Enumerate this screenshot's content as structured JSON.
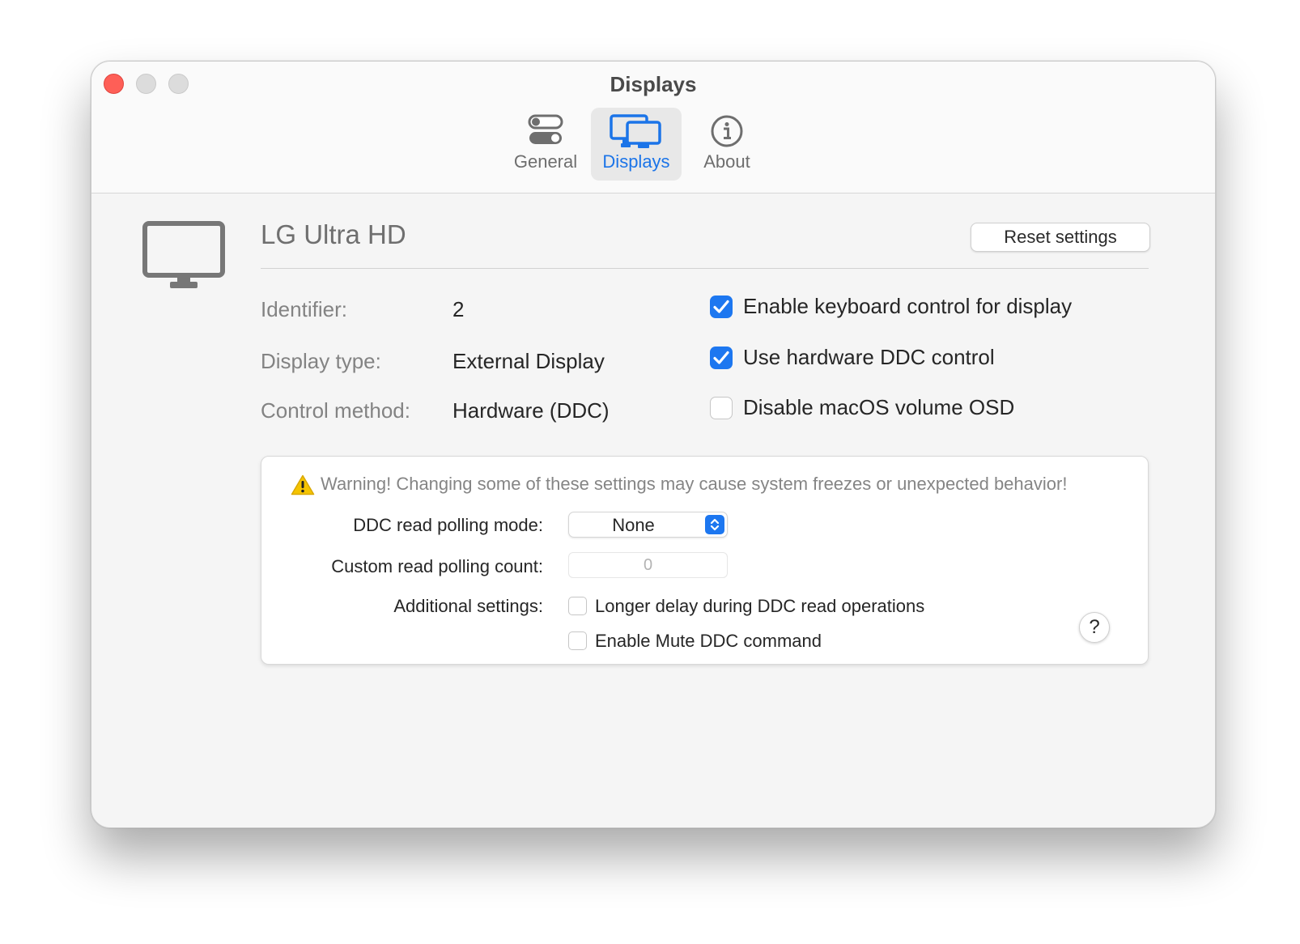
{
  "window": {
    "title": "Displays"
  },
  "tabs": [
    {
      "label": "General",
      "icon": "toggles-icon",
      "active": false
    },
    {
      "label": "Displays",
      "icon": "displays-icon",
      "active": true
    },
    {
      "label": "About",
      "icon": "info-icon",
      "active": false
    }
  ],
  "display": {
    "name": "LG Ultra HD",
    "reset_label": "Reset settings",
    "info": [
      {
        "label": "Identifier:",
        "value": "2"
      },
      {
        "label": "Display type:",
        "value": "External Display"
      },
      {
        "label": "Control method:",
        "value": "Hardware (DDC)"
      }
    ],
    "options": [
      {
        "label": "Enable keyboard control for display",
        "checked": true
      },
      {
        "label": "Use hardware DDC control",
        "checked": true
      },
      {
        "label": "Disable macOS volume OSD",
        "checked": false
      }
    ]
  },
  "advanced": {
    "warning": "Warning! Changing some of these settings may cause system freezes or unexpected behavior!",
    "polling_mode_label": "DDC read polling mode:",
    "polling_mode_value": "None",
    "polling_count_label": "Custom read polling count:",
    "polling_count_placeholder": "0",
    "additional_label": "Additional settings:",
    "additional_options": [
      {
        "label": "Longer delay during DDC read operations",
        "checked": false
      },
      {
        "label": "Enable Mute DDC command",
        "checked": false
      }
    ],
    "help_label": "?"
  },
  "colors": {
    "accent": "#1d77f0",
    "close": "#fe5f57",
    "warning": "#f5c400"
  }
}
